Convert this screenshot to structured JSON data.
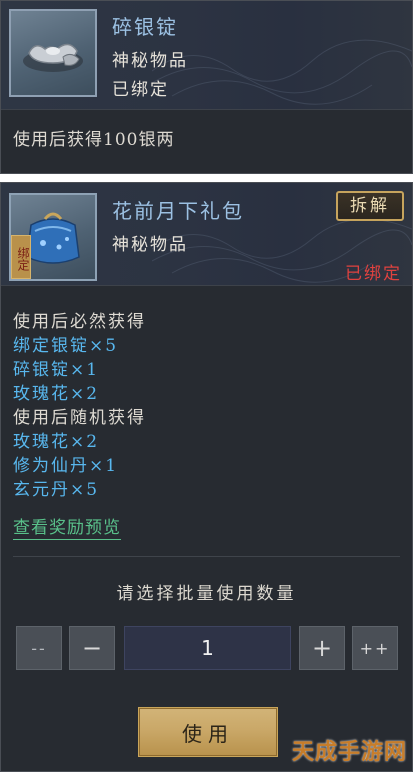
{
  "item1": {
    "name": "碎银锭",
    "type": "神秘物品",
    "status": "已绑定",
    "description": "使用后获得100银两",
    "icon": "silver-ingot-icon"
  },
  "item2": {
    "name": "花前月下礼包",
    "type": "神秘物品",
    "bound_badge": "绑定",
    "split_label": "拆解",
    "status": "已绑定",
    "icon": "gift-bag-icon",
    "lines": [
      {
        "text": "使用后必然获得",
        "color": "white"
      },
      {
        "text": "绑定银锭×5",
        "color": "blue"
      },
      {
        "text": "碎银锭×1",
        "color": "blue"
      },
      {
        "text": "玫瑰花×2",
        "color": "blue"
      },
      {
        "text": "使用后随机获得",
        "color": "white"
      },
      {
        "text": "玫瑰花×2",
        "color": "blue"
      },
      {
        "text": "修为仙丹×1",
        "color": "blue"
      },
      {
        "text": "玄元丹×5",
        "color": "blue"
      }
    ],
    "preview_link": "查看奖励预览"
  },
  "batch": {
    "prompt": "请选择批量使用数量",
    "dec10_label": "--",
    "dec1_label": "−",
    "quantity": "1",
    "inc1_label": "+",
    "inc10_label": "++",
    "use_label": "使用"
  },
  "watermark": "天成手游网",
  "colors": {
    "name_blue": "#9cc1e3",
    "item_blue": "#58b7ee",
    "bound_red": "#e0423f",
    "link_green": "#59c08a",
    "gold": "#c9a65b"
  }
}
